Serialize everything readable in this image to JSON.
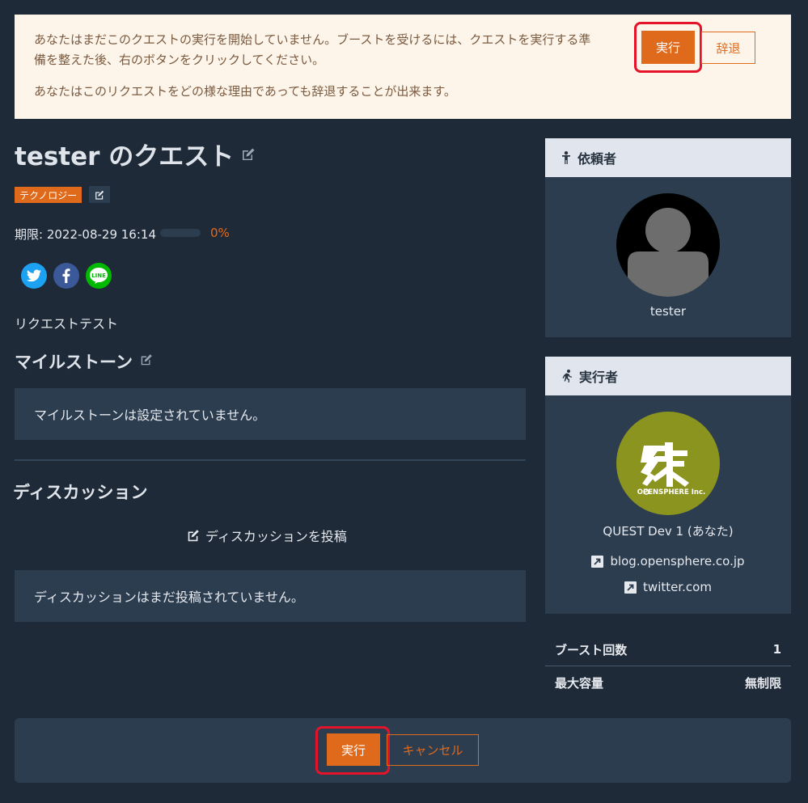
{
  "notice": {
    "line1": "あなたはまだこのクエストの実行を開始していません。ブーストを受けるには、クエストを実行する準備を整えた後、右のボタンをクリックしてください。",
    "line2": "あなたはこのリクエストをどの様な理由であっても辞退することが出来ます。",
    "execute_label": "実行",
    "decline_label": "辞退"
  },
  "quest": {
    "title": "tester のクエスト",
    "tag": "テクノロジー",
    "deadline": "期限: 2022-08-29 16:14",
    "progress_pct": 0,
    "progress_text": "0%",
    "description": "リクエストテスト"
  },
  "social": {
    "twitter_color": "#1da1f2",
    "facebook_color": "#3b5998",
    "line_color": "#00b900",
    "line_text": "LINE"
  },
  "milestone": {
    "heading": "マイルストーン",
    "empty": "マイルストーンは設定されていません。"
  },
  "discussion": {
    "heading": "ディスカッション",
    "post_label": "ディスカッションを投稿",
    "empty": "ディスカッションはまだ投稿されていません。"
  },
  "requester": {
    "heading": "依頼者",
    "name": "tester"
  },
  "executor": {
    "heading": "実行者",
    "name": "QUEST Dev 1 (あなた)",
    "logo_brand": "OPENSPHERE Inc.",
    "links": [
      "blog.opensphere.co.jp",
      "twitter.com"
    ]
  },
  "stats": [
    {
      "label": "ブースト回数",
      "value": "1"
    },
    {
      "label": "最大容量",
      "value": "無制限"
    }
  ],
  "footer": {
    "execute_label": "実行",
    "cancel_label": "キャンセル"
  },
  "colors": {
    "accent": "#e06a1b",
    "highlight": "#e4132a",
    "background": "#1f2a38",
    "panel": "#2c3d50"
  }
}
